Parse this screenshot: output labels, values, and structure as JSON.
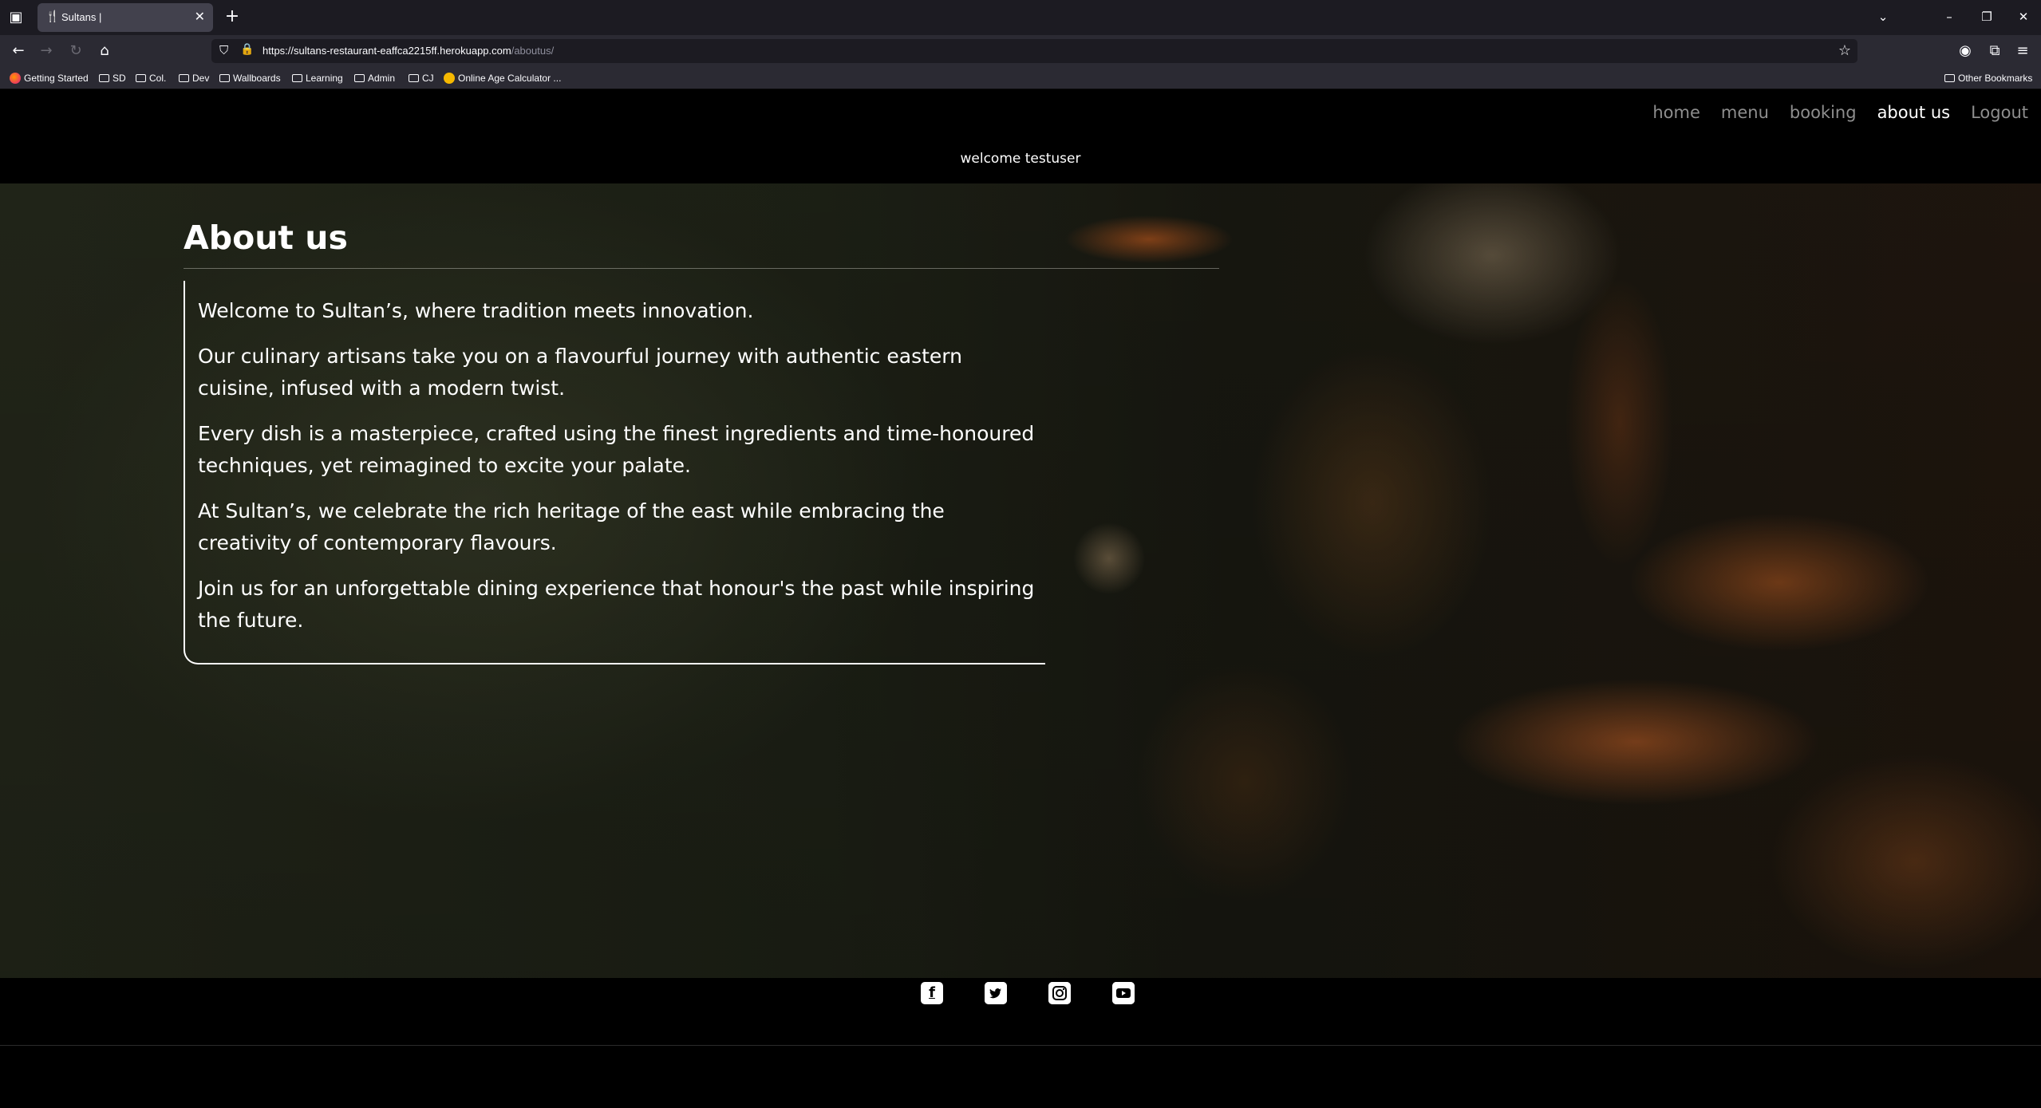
{
  "browser": {
    "tab_title": "Sultans |",
    "url_main": "https://sultans-restaurant-eaffca2215ff.herokuapp.com",
    "url_path": "/aboutus/",
    "bookmarks": [
      "Getting Started",
      "SD",
      "Col.",
      "Dev",
      "Wallboards",
      "Learning",
      "Admin",
      "CJ",
      "Online Age Calculator ..."
    ],
    "other_bookmarks": "Other Bookmarks"
  },
  "site": {
    "nav": [
      {
        "label": "home"
      },
      {
        "label": "menu"
      },
      {
        "label": "booking"
      },
      {
        "label": "about us",
        "active": true
      },
      {
        "label": "Logout"
      }
    ],
    "welcome": "welcome testuser"
  },
  "about": {
    "title": "About us",
    "paragraphs": [
      "Welcome to Sultan’s, where tradition meets innovation.",
      "Our culinary artisans take you on a flavourful journey with authentic eastern cuisine, infused with a modern twist.",
      "Every dish is a masterpiece, crafted using the finest ingredients and time-honoured techniques, yet reimagined to excite your palate.",
      "At Sultan’s, we celebrate the rich heritage of the east while embracing the creativity of contemporary flavours.",
      "Join us for an unforgettable dining experience that honour's the past while inspiring the future."
    ]
  },
  "footer": {
    "social_icons": [
      "facebook-icon",
      "twitter-icon",
      "instagram-icon",
      "youtube-icon"
    ]
  }
}
